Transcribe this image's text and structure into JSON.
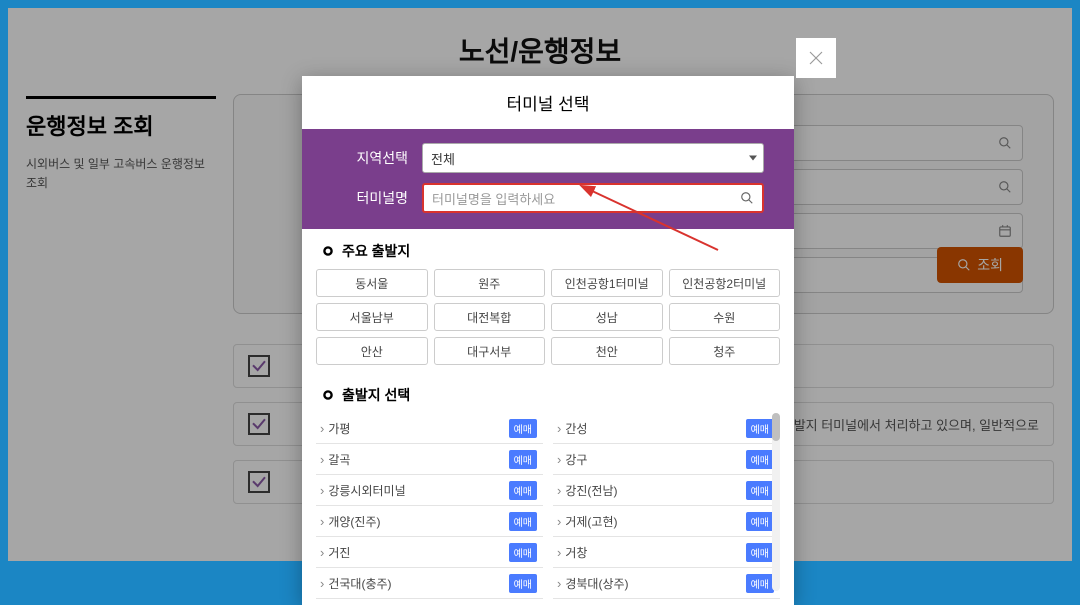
{
  "page": {
    "title": "노선/운행정보"
  },
  "sidebar": {
    "title": "운행정보 조회",
    "desc": "시외버스 및 일부 고속버스 운행정보 조회"
  },
  "search_panel": {
    "button_label": "조회",
    "note_trailing": "은 출발지 터미널에서 처리하고 있으며, 일반적으로"
  },
  "modal": {
    "title": "터미널 선택",
    "region_label": "지역선택",
    "region_value": "전체",
    "name_label": "터미널명",
    "name_placeholder": "터미널명을 입력하세요",
    "popular_header": "주요 출발지",
    "popular": [
      "동서울",
      "원주",
      "인천공항1터미널",
      "인천공항2터미널",
      "서울남부",
      "대전복합",
      "성남",
      "수원",
      "안산",
      "대구서부",
      "천안",
      "청주"
    ],
    "select_header": "출발지 선택",
    "badge": "예매",
    "terminals_left": [
      "가평",
      "갈곡",
      "강릉시외터미널",
      "개양(진주)",
      "거진",
      "건국대(충주)"
    ],
    "terminals_right": [
      "간성",
      "강구",
      "강진(전남)",
      "거제(고현)",
      "거창",
      "경북대(상주)"
    ]
  }
}
